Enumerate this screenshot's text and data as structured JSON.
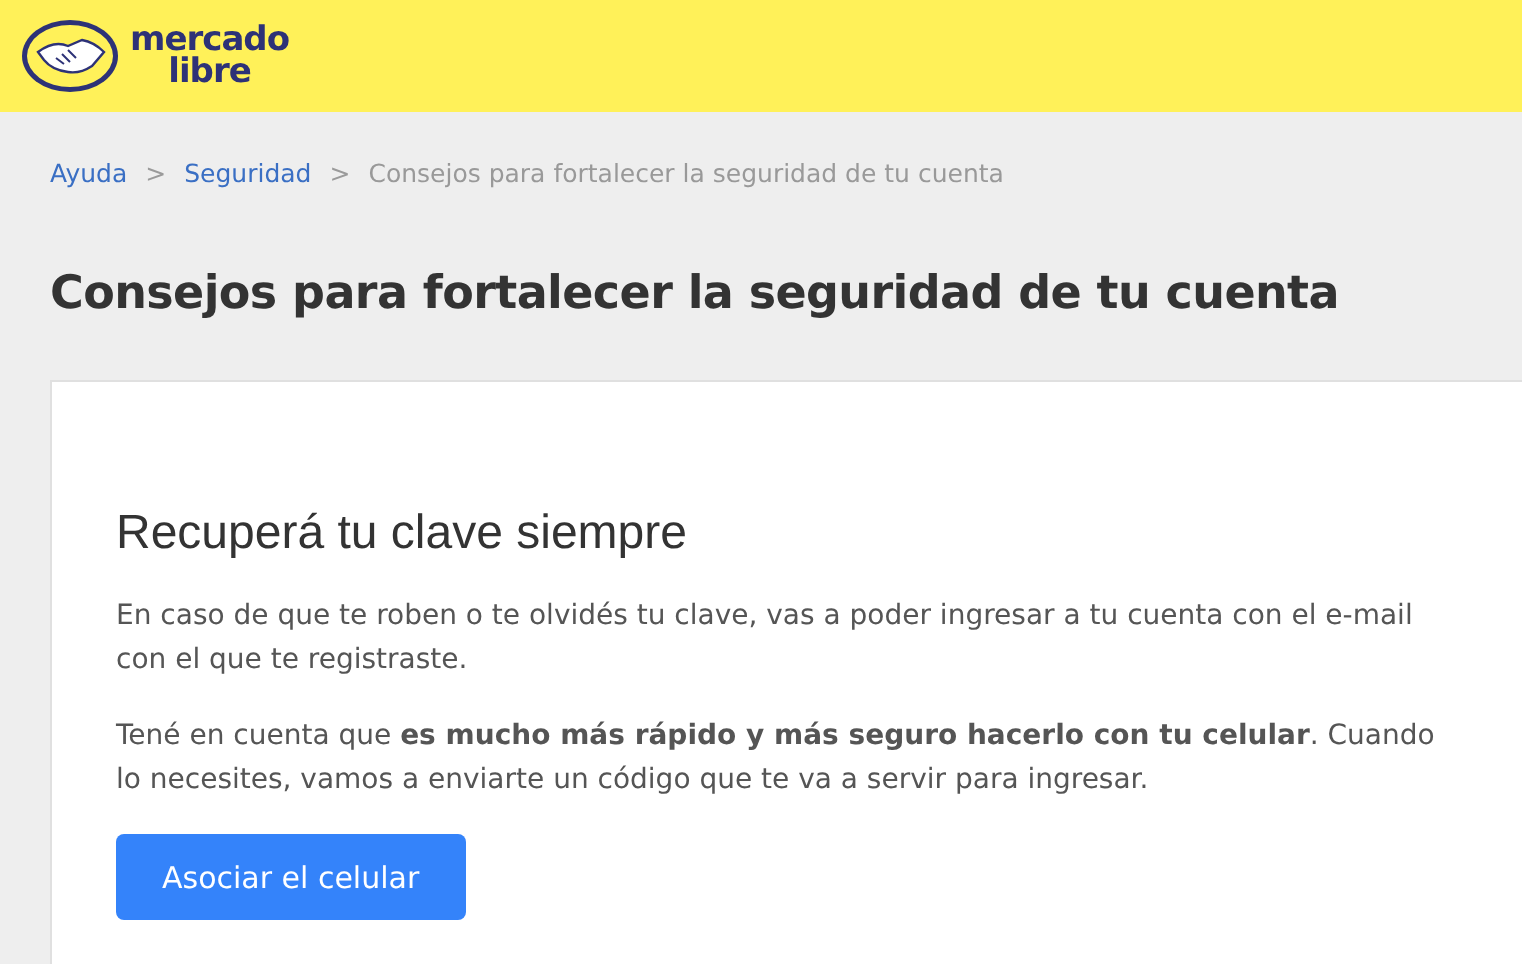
{
  "header": {
    "logo_lines": [
      "mercado",
      "libre"
    ]
  },
  "breadcrumb": [
    {
      "kind": "link",
      "text": "Ayuda"
    },
    {
      "kind": "separator",
      "text": ">"
    },
    {
      "kind": "link",
      "text": "Seguridad"
    },
    {
      "kind": "separator",
      "text": ">"
    },
    {
      "kind": "current",
      "text": "Consejos para fortalecer la seguridad de tu cuenta"
    }
  ],
  "page_title": "Consejos para fortalecer la seguridad de tu cuenta",
  "card": {
    "heading": "Recuperá tu clave siempre",
    "paragraphs": [
      "En caso de que te roben o te olvidés tu clave, vas a poder ingresar a tu cuenta con el e-mail con el que te registraste.",
      "Tené en cuenta que **es mucho más rápido y más seguro hacerlo con tu celular**. Cuando lo necesites, vamos a enviarte un código que te va a servir para ingresar."
    ],
    "button": "Asociar el celular"
  }
}
